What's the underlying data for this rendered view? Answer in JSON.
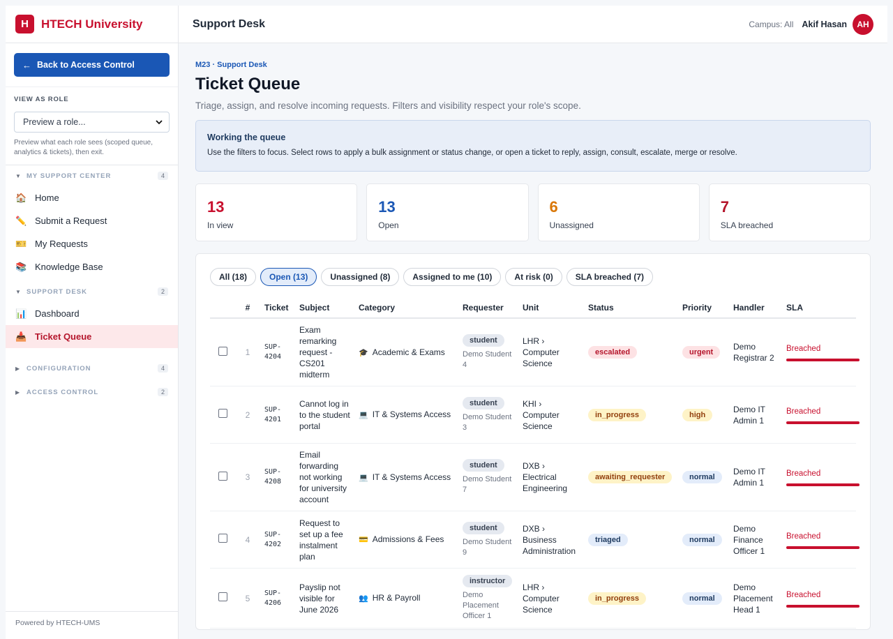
{
  "brand": {
    "logo_letter": "H",
    "name": "HTECH University"
  },
  "sidebar": {
    "back_label": "Back to Access Control",
    "back_arrow": "←",
    "view_as_role": {
      "title": "VIEW AS ROLE",
      "select_value": "Preview a role...",
      "help": "Preview what each role sees (scoped queue, analytics & tickets), then exit."
    },
    "sections": [
      {
        "label": "MY SUPPORT CENTER",
        "count": "4",
        "expanded": true,
        "items": [
          {
            "label": "Home",
            "icon": "🏠",
            "icon_name": "home-icon"
          },
          {
            "label": "Submit a Request",
            "icon": "✏️",
            "icon_name": "pencil-icon"
          },
          {
            "label": "My Requests",
            "icon": "🎫",
            "icon_name": "ticket-icon"
          },
          {
            "label": "Knowledge Base",
            "icon": "📚",
            "icon_name": "books-icon"
          }
        ]
      },
      {
        "label": "SUPPORT DESK",
        "count": "2",
        "expanded": true,
        "items": [
          {
            "label": "Dashboard",
            "icon": "📊",
            "icon_name": "bar-chart-icon"
          },
          {
            "label": "Ticket Queue",
            "icon": "📥",
            "icon_name": "inbox-icon",
            "active": true
          }
        ]
      },
      {
        "label": "CONFIGURATION",
        "count": "4",
        "expanded": false,
        "items": []
      },
      {
        "label": "ACCESS CONTROL",
        "count": "2",
        "expanded": false,
        "items": []
      }
    ],
    "powered_by": "Powered by HTECH-UMS"
  },
  "header": {
    "title": "Support Desk",
    "campus": "Campus: All",
    "user_name": "Akif Hasan",
    "avatar_initials": "AH"
  },
  "main": {
    "breadcrumb": "M23 · Support Desk",
    "title": "Ticket Queue",
    "subtitle": "Triage, assign, and resolve incoming requests. Filters and visibility respect your role's scope.",
    "info": {
      "title": "Working the queue",
      "text": "Use the filters to focus. Select rows to apply a bulk assignment or status change, or open a ticket to reply, assign, consult, escalate, merge or resolve."
    },
    "stats": [
      {
        "value": "13",
        "label": "In view",
        "color": "#c8102e"
      },
      {
        "value": "13",
        "label": "Open",
        "color": "#1a57b5"
      },
      {
        "value": "6",
        "label": "Unassigned",
        "color": "#d97706"
      },
      {
        "value": "7",
        "label": "SLA breached",
        "color": "#b5162c"
      }
    ],
    "filters": [
      {
        "label": "All (18)",
        "active": false
      },
      {
        "label": "Open (13)",
        "active": true
      },
      {
        "label": "Unassigned (8)",
        "active": false
      },
      {
        "label": "Assigned to me (10)",
        "active": false
      },
      {
        "label": "At risk (0)",
        "active": false
      },
      {
        "label": "SLA breached (7)",
        "active": false
      }
    ],
    "columns": [
      "",
      "#",
      "Ticket",
      "Subject",
      "Category",
      "Requester",
      "Unit",
      "Status",
      "Priority",
      "Handler",
      "SLA"
    ],
    "rows": [
      {
        "idx": "1",
        "ticket": "SUP-4204",
        "subject": "Exam remarking request - CS201 midterm",
        "category": "Academic & Exams",
        "cat_icon": "🎓",
        "role": "student",
        "requester": "Demo Student 4",
        "unit": "LHR › Computer Science",
        "status": "escalated",
        "status_bg": "#fde2e4",
        "status_fg": "#b5162c",
        "priority": "urgent",
        "prio_bg": "#fde2e4",
        "prio_fg": "#b5162c",
        "handler": "Demo Registrar 2",
        "sla": "Breached"
      },
      {
        "idx": "2",
        "ticket": "SUP-4201",
        "subject": "Cannot log in to the student portal",
        "category": "IT & Systems Access",
        "cat_icon": "💻",
        "role": "student",
        "requester": "Demo Student 3",
        "unit": "KHI › Computer Science",
        "status": "in_progress",
        "status_bg": "#fef3c7",
        "status_fg": "#92400e",
        "priority": "high",
        "prio_bg": "#fef3c7",
        "prio_fg": "#92400e",
        "handler": "Demo IT Admin 1",
        "sla": "Breached"
      },
      {
        "idx": "3",
        "ticket": "SUP-4208",
        "subject": "Email forwarding not working for university account",
        "category": "IT & Systems Access",
        "cat_icon": "💻",
        "role": "student",
        "requester": "Demo Student 7",
        "unit": "DXB › Electrical Engineering",
        "status": "awaiting_requester",
        "status_bg": "#fef3c7",
        "status_fg": "#92400e",
        "priority": "normal",
        "prio_bg": "#e3ecfa",
        "prio_fg": "#1e3a5f",
        "handler": "Demo IT Admin 1",
        "sla": "Breached"
      },
      {
        "idx": "4",
        "ticket": "SUP-4202",
        "subject": "Request to set up a fee instalment plan",
        "category": "Admissions & Fees",
        "cat_icon": "💳",
        "role": "student",
        "requester": "Demo Student 9",
        "unit": "DXB › Business Administration",
        "status": "triaged",
        "status_bg": "#e3ecfa",
        "status_fg": "#1e3a5f",
        "priority": "normal",
        "prio_bg": "#e3ecfa",
        "prio_fg": "#1e3a5f",
        "handler": "Demo Finance Officer 1",
        "sla": "Breached"
      },
      {
        "idx": "5",
        "ticket": "SUP-4206",
        "subject": "Payslip not visible for June 2026",
        "category": "HR & Payroll",
        "cat_icon": "👥",
        "role": "instructor",
        "requester": "Demo Placement Officer 1",
        "unit": "LHR › Computer Science",
        "status": "in_progress",
        "status_bg": "#fef3c7",
        "status_fg": "#92400e",
        "priority": "normal",
        "prio_bg": "#e3ecfa",
        "prio_fg": "#1e3a5f",
        "handler": "Demo Placement Head 1",
        "sla": "Breached"
      }
    ]
  }
}
